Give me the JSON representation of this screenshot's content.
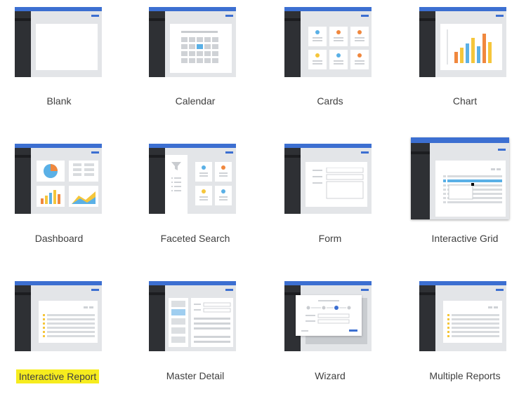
{
  "templates": [
    {
      "label": "Blank"
    },
    {
      "label": "Calendar"
    },
    {
      "label": "Cards"
    },
    {
      "label": "Chart"
    },
    {
      "label": "Dashboard"
    },
    {
      "label": "Faceted Search"
    },
    {
      "label": "Form"
    },
    {
      "label": "Interactive Grid"
    },
    {
      "label": "Interactive Report"
    },
    {
      "label": "Master Detail"
    },
    {
      "label": "Wizard"
    },
    {
      "label": "Multiple Reports"
    }
  ],
  "highlighted_template": "Interactive Report",
  "colors": {
    "header_blue": "#3c6fd1",
    "sidebar_dark": "#2e3034",
    "highlight_yellow": "#f6ec1e",
    "accent_orange": "#f0883e",
    "accent_yellow": "#f5c63b",
    "accent_light_blue": "#5ab0e6"
  }
}
